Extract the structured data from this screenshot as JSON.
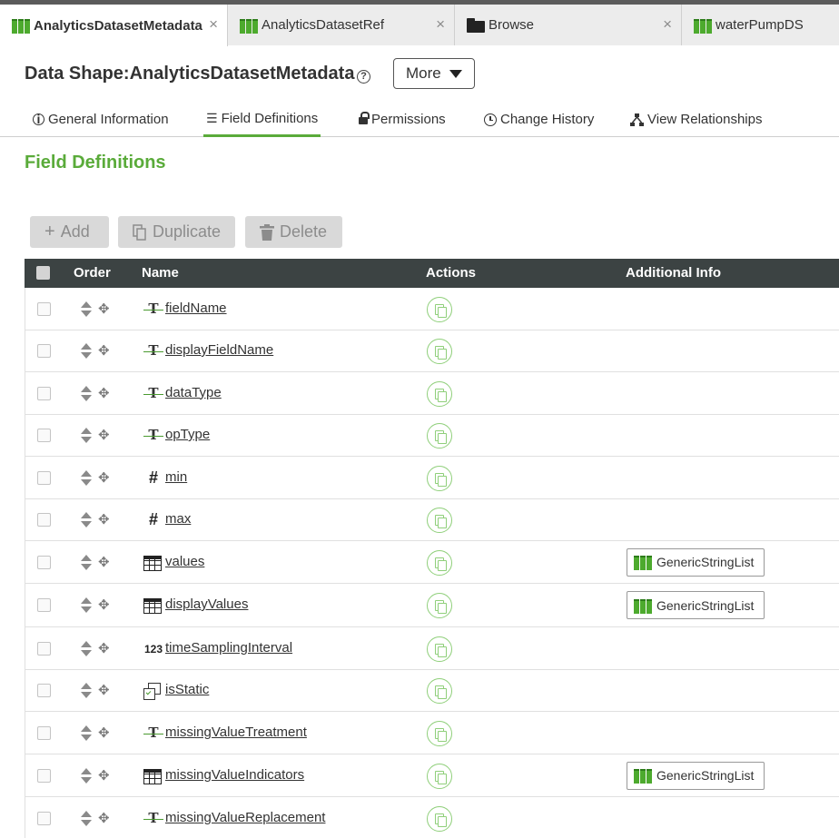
{
  "tabs": [
    {
      "label": "AnalyticsDatasetMetadata",
      "icon": "datashape-icon",
      "active": true
    },
    {
      "label": "AnalyticsDatasetRef",
      "icon": "datashape-icon",
      "active": false
    },
    {
      "label": "Browse",
      "icon": "folder-icon",
      "active": false
    },
    {
      "label": "waterPumpDS",
      "icon": "datashape-icon",
      "active": false
    }
  ],
  "tab_close": "×",
  "header": {
    "title": "Data Shape:AnalyticsDatasetMetadata",
    "help": "?",
    "more_label": "More"
  },
  "subnav": [
    {
      "label": "General Information",
      "icon": "info-icon"
    },
    {
      "label": "Field Definitions",
      "icon": "list-icon",
      "active": true
    },
    {
      "label": "Permissions",
      "icon": "lock-icon"
    },
    {
      "label": "Change History",
      "icon": "clock-icon"
    },
    {
      "label": "View Relationships",
      "icon": "relationships-icon"
    }
  ],
  "section_title": "Field Definitions",
  "toolbar": {
    "add": "Add",
    "duplicate": "Duplicate",
    "delete": "Delete"
  },
  "columns": {
    "order": "Order",
    "name": "Name",
    "actions": "Actions",
    "additional_info": "Additional Info"
  },
  "type_labels": {
    "int": "123",
    "num": "#"
  },
  "rows": [
    {
      "name": "fieldName",
      "type": "text",
      "info": ""
    },
    {
      "name": "displayFieldName",
      "type": "text",
      "info": ""
    },
    {
      "name": "dataType",
      "type": "text",
      "info": ""
    },
    {
      "name": "opType",
      "type": "text",
      "info": ""
    },
    {
      "name": "min",
      "type": "number",
      "info": ""
    },
    {
      "name": "max",
      "type": "number",
      "info": ""
    },
    {
      "name": "values",
      "type": "infotable",
      "info": "GenericStringList"
    },
    {
      "name": "displayValues",
      "type": "infotable",
      "info": "GenericStringList"
    },
    {
      "name": "timeSamplingInterval",
      "type": "integer",
      "info": ""
    },
    {
      "name": "isStatic",
      "type": "boolean",
      "info": ""
    },
    {
      "name": "missingValueTreatment",
      "type": "text",
      "info": ""
    },
    {
      "name": "missingValueIndicators",
      "type": "infotable",
      "info": "GenericStringList"
    },
    {
      "name": "missingValueReplacement",
      "type": "text",
      "info": ""
    }
  ],
  "colors": {
    "accent": "#5aab3a",
    "header_bg": "#3c4343",
    "datashape_green": "#4daa2e"
  }
}
